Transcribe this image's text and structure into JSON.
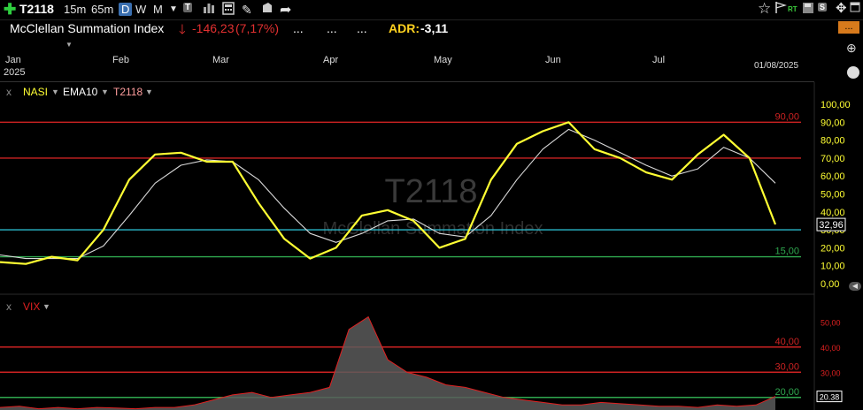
{
  "toolbar": {
    "symbol": "T2118",
    "intervals": [
      "15m",
      "65m",
      "D",
      "W",
      "M"
    ],
    "selected_interval": "D",
    "tool_labels": [
      "T",
      "S",
      "RT"
    ]
  },
  "header": {
    "index_name": "McClellan Summation Index",
    "change": "-146,23",
    "change_pct": "(7,17%)",
    "dots": [
      "...",
      "...",
      "..."
    ],
    "adr_label": "ADR:",
    "adr_value": "-3,11",
    "orange_button": "..."
  },
  "timeline": {
    "left_top": "Jan",
    "left_bottom": "2025",
    "months": [
      "Feb",
      "Mar",
      "Apr",
      "May",
      "Jun",
      "Jul"
    ],
    "date": "01/08/2025"
  },
  "colors": {
    "nasi": "#ffff33",
    "ema10": "#d9d9d9",
    "red_line": "#cc2222",
    "cyan_line": "#2ab7c9",
    "green_line": "#2fa84f",
    "vix_fill": "#5a5a5a",
    "vix_line": "#e02020"
  },
  "chart_data": [
    {
      "type": "line",
      "title": "T2118",
      "subtitle": "McClellan Summation Index",
      "legend": [
        "NASI",
        "EMA10",
        "T2118"
      ],
      "close_label": "x",
      "ylim": [
        0,
        100
      ],
      "y_ticks": [
        "100,00",
        "90,00",
        "80,00",
        "70,00",
        "60,00",
        "50,00",
        "40,00",
        "30,00",
        "20,00",
        "10,00",
        "0,00"
      ],
      "reference_lines": [
        {
          "value": 90,
          "label": "90,00",
          "color": "#cc2222"
        },
        {
          "value": 70,
          "label": "",
          "color": "#cc2222"
        },
        {
          "value": 30,
          "label": "",
          "color": "#2ab7c9"
        },
        {
          "value": 15,
          "label": "15,00",
          "color": "#2fa84f"
        }
      ],
      "last_value": "32,96",
      "x": [
        "Jan",
        "Jan",
        "Jan",
        "Jan",
        "Jan",
        "Feb",
        "Feb",
        "Feb",
        "Feb",
        "Mar",
        "Mar",
        "Mar",
        "Mar",
        "Apr",
        "Apr",
        "Apr",
        "Apr",
        "Apr",
        "May",
        "May",
        "May",
        "May",
        "Jun",
        "Jun",
        "Jun",
        "Jun",
        "Jul",
        "Jul",
        "Jul",
        "Jul",
        "Aug"
      ],
      "series": [
        {
          "name": "NASI",
          "values": [
            12,
            11,
            15,
            13,
            30,
            58,
            72,
            73,
            68,
            68,
            45,
            25,
            14,
            20,
            38,
            41,
            35,
            20,
            25,
            58,
            78,
            85,
            90,
            75,
            70,
            62,
            58,
            72,
            83,
            70,
            33
          ]
        },
        {
          "name": "EMA10",
          "values": [
            16,
            14,
            14,
            14,
            21,
            38,
            56,
            66,
            69,
            68,
            58,
            42,
            28,
            23,
            28,
            35,
            36,
            28,
            26,
            38,
            58,
            75,
            86,
            80,
            73,
            66,
            60,
            64,
            76,
            70,
            56
          ]
        }
      ]
    },
    {
      "type": "area",
      "title": "VIX",
      "close_label": "x",
      "ylim": [
        15,
        55
      ],
      "y_ticks": [
        "50,00",
        "40,00",
        "30,00",
        "20,00"
      ],
      "reference_lines": [
        {
          "value": 40,
          "label": "40,00",
          "color": "#cc2222"
        },
        {
          "value": 30,
          "label": "30,00",
          "color": "#cc2222"
        },
        {
          "value": 20,
          "label": "20,00",
          "color": "#2fa84f"
        }
      ],
      "last_value": "20.38",
      "series": [
        {
          "name": "VIX",
          "values": [
            16,
            16.5,
            15.5,
            16,
            15.5,
            16,
            15.8,
            15.5,
            16,
            16,
            17,
            19,
            21,
            22,
            20,
            21,
            22,
            24,
            47,
            52,
            35,
            30,
            28,
            25,
            24,
            22,
            20,
            19,
            18,
            17,
            17,
            18,
            17.5,
            17,
            16.5,
            16.5,
            16,
            17,
            16.5,
            17,
            20.4
          ]
        }
      ]
    }
  ]
}
